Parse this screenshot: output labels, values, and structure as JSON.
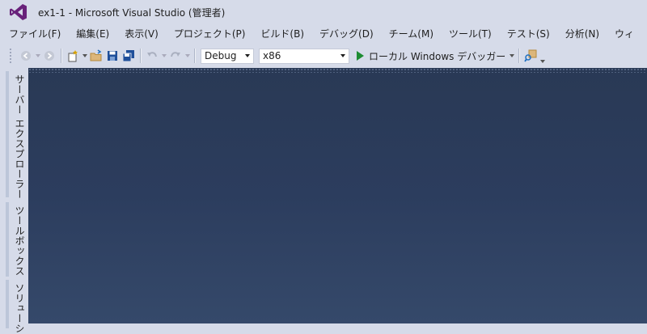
{
  "window": {
    "title": "ex1-1 - Microsoft Visual Studio (管理者)"
  },
  "menu": [
    {
      "label": "ファイル(F)"
    },
    {
      "label": "編集(E)"
    },
    {
      "label": "表示(V)"
    },
    {
      "label": "プロジェクト(P)"
    },
    {
      "label": "ビルド(B)"
    },
    {
      "label": "デバッグ(D)"
    },
    {
      "label": "チーム(M)"
    },
    {
      "label": "ツール(T)"
    },
    {
      "label": "テスト(S)"
    },
    {
      "label": "分析(N)"
    },
    {
      "label": "ウィ"
    }
  ],
  "toolbar": {
    "configuration": "Debug",
    "platform": "x86",
    "start_debugger_label": "ローカル Windows デバッガー"
  },
  "side_tabs": [
    {
      "label": "サーバー エクスプローラー"
    },
    {
      "label": "ツールボックス"
    },
    {
      "label": "ソリューシ"
    }
  ],
  "icons": {
    "logo": "visual-studio-logo-icon",
    "back": "back-arrow-icon",
    "forward": "forward-arrow-icon",
    "new_project": "new-project-icon",
    "open_file": "open-folder-icon",
    "save": "save-icon",
    "save_all": "save-all-icon",
    "undo": "undo-icon",
    "redo": "redo-icon",
    "start": "play-icon",
    "find": "find-in-files-icon"
  },
  "colors": {
    "chrome": "#d6dbe9",
    "editor_top": "#293955",
    "editor_bottom": "#35496a",
    "logo": "#68217a",
    "play": "#1d8c32"
  }
}
